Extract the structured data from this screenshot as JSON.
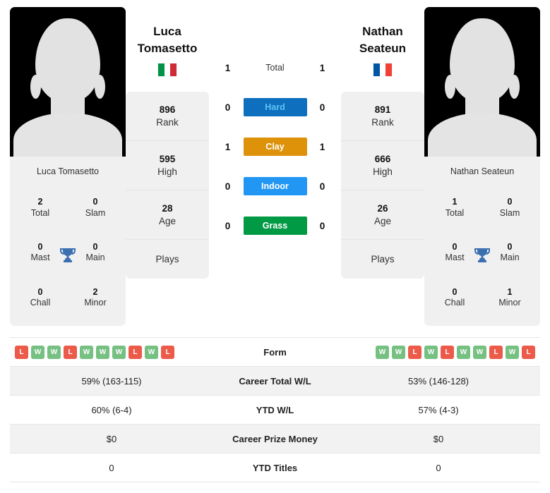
{
  "players": {
    "left": {
      "first_name": "Luca",
      "last_name": "Tomasetto",
      "full_name": "Luca Tomasetto",
      "country": "Italy",
      "flag_colors": [
        "#009246",
        "#ffffff",
        "#ce2b37"
      ],
      "stats": [
        {
          "value": "896",
          "label": "Rank"
        },
        {
          "value": "595",
          "label": "High"
        },
        {
          "value": "28",
          "label": "Age"
        },
        {
          "value": "",
          "label": "Plays"
        }
      ],
      "titles": [
        {
          "value": "2",
          "label": "Total"
        },
        {
          "value": "0",
          "label": "Slam"
        },
        {
          "value": "0",
          "label": "Mast"
        },
        {
          "value": "0",
          "label": "Main"
        },
        {
          "value": "0",
          "label": "Chall"
        },
        {
          "value": "2",
          "label": "Minor"
        }
      ],
      "form": [
        "L",
        "W",
        "W",
        "L",
        "W",
        "W",
        "W",
        "L",
        "W",
        "L"
      ],
      "career_total_wl": "59% (163-115)",
      "ytd_wl": "60% (6-4)",
      "career_prize_money": "$0",
      "ytd_titles": "0"
    },
    "right": {
      "first_name": "Nathan",
      "last_name": "Seateun",
      "full_name": "Nathan Seateun",
      "country": "France",
      "flag_colors": [
        "#0055a4",
        "#ffffff",
        "#ef4135"
      ],
      "stats": [
        {
          "value": "891",
          "label": "Rank"
        },
        {
          "value": "666",
          "label": "High"
        },
        {
          "value": "26",
          "label": "Age"
        },
        {
          "value": "",
          "label": "Plays"
        }
      ],
      "titles": [
        {
          "value": "1",
          "label": "Total"
        },
        {
          "value": "0",
          "label": "Slam"
        },
        {
          "value": "0",
          "label": "Mast"
        },
        {
          "value": "0",
          "label": "Main"
        },
        {
          "value": "0",
          "label": "Chall"
        },
        {
          "value": "1",
          "label": "Minor"
        }
      ],
      "form": [
        "W",
        "W",
        "L",
        "W",
        "L",
        "W",
        "W",
        "L",
        "W",
        "L"
      ],
      "career_total_wl": "53% (146-128)",
      "ytd_wl": "57% (4-3)",
      "career_prize_money": "$0",
      "ytd_titles": "0"
    }
  },
  "head_to_head": [
    {
      "surface": "Total",
      "left_score": "1",
      "right_score": "1",
      "bg": "transparent",
      "fg": "#333333"
    },
    {
      "surface": "Hard",
      "left_score": "0",
      "right_score": "0",
      "bg": "#0d6fbd",
      "fg": "#5fc3f5"
    },
    {
      "surface": "Clay",
      "left_score": "1",
      "right_score": "1",
      "bg": "#dd9209",
      "fg": "#ffffff"
    },
    {
      "surface": "Indoor",
      "left_score": "0",
      "right_score": "0",
      "bg": "#2196f3",
      "fg": "#ffffff"
    },
    {
      "surface": "Grass",
      "left_score": "0",
      "right_score": "0",
      "bg": "#009a44",
      "fg": "#ffffff"
    }
  ],
  "comparison_rows": [
    {
      "label": "Form",
      "type": "form",
      "left": "",
      "right": ""
    },
    {
      "label": "Career Total W/L",
      "type": "text",
      "left": "59% (163-115)",
      "right": "53% (146-128)"
    },
    {
      "label": "YTD W/L",
      "type": "text",
      "left": "60% (6-4)",
      "right": "57% (4-3)"
    },
    {
      "label": "Career Prize Money",
      "type": "text",
      "left": "$0",
      "right": "$0"
    },
    {
      "label": "YTD Titles",
      "type": "text",
      "left": "0",
      "right": "0"
    }
  ],
  "icons": {
    "trophy": "trophy-icon",
    "avatar": "avatar-placeholder-icon"
  },
  "colors": {
    "win": "#76c082",
    "loss": "#ec5b4a",
    "trophy": "#3a6fb0",
    "card_bg": "#f0f0f0",
    "stripe_bg": "#f2f2f2"
  }
}
